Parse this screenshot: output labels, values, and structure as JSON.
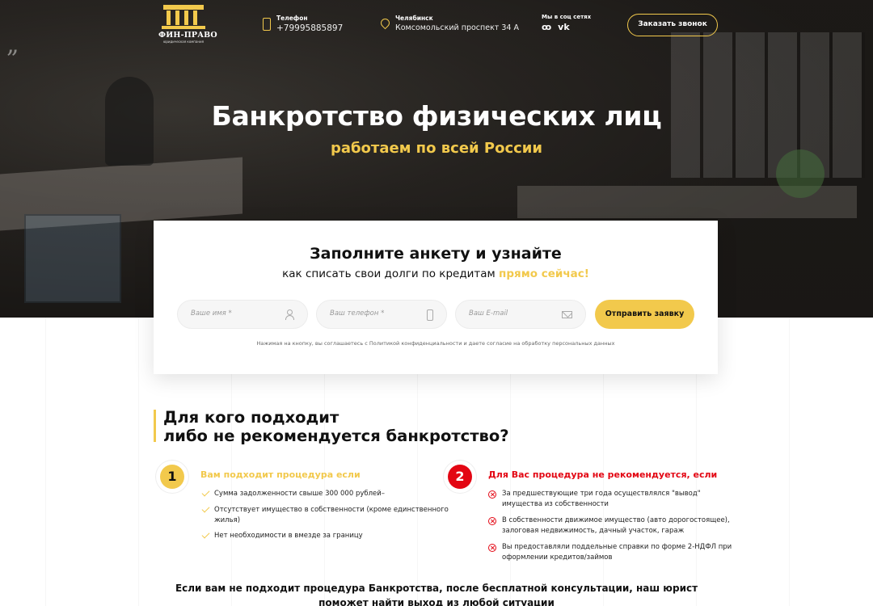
{
  "header": {
    "logo_title": "ФИН-ПРАВО",
    "logo_subtitle": "юридическая компания",
    "phone_label": "Телефон",
    "phone_value": "+79995885897",
    "city_label": "Челябинск",
    "address_value": "Комсомольский проспект 34 А",
    "social_label": "Мы в соц сетях",
    "social_icons": [
      "odnoklassniki-icon",
      "vk-icon"
    ],
    "call_button": "Заказать звонок"
  },
  "hero": {
    "title": "Банкротство физических лиц",
    "subtitle": "работаем по всей России"
  },
  "form": {
    "title": "Заполните анкету и узнайте",
    "subtitle_main": "как списать свои долги по кредитам ",
    "subtitle_accent": "прямо сейчас!",
    "name_placeholder": "Ваше имя  *",
    "phone_placeholder": "Ваш телефон  *",
    "email_placeholder": "Ваш E-mail",
    "submit_label": "Отправить заявку",
    "consent": "Нажимая на кнопку, вы соглашаетесь с Политикой конфиденциальности и даете согласие на обработку персональных данных"
  },
  "suitability": {
    "title_line1": "Для кого подходит",
    "title_line2": "либо не рекомендуется банкротство?",
    "left": {
      "number": "1",
      "title": "Вам подходит процедура если",
      "items": [
        " Сумма задолженности свыше 300 000 рублей–",
        "Отсутствует имущество в собственности (кроме единственного",
        "жилья)",
        "Нет необходимости в вмезде за границу"
      ]
    },
    "right": {
      "number": "2",
      "title": "Для Вас процедура не рекомендуется, если",
      "items": [
        "За предшествующие три года осуществлялся \"вывод\"",
        "имущества из собственности",
        "В собственности движимое имущество (авто дорогостоящее),",
        "залоговая недвижимость, дачный участок, гараж",
        "Вы предоставляли поддельные справки по форме 2-НДФЛ при",
        "оформлении кредитов/займов"
      ]
    },
    "bottom_line1": "Если вам не подходит процедура Банкротства, после бесплатной консультации, наш юрист",
    "bottom_line2": "поможет найти выход из любой ситуации"
  },
  "colors": {
    "accent_yellow": "#f2c94c",
    "accent_red": "#e30613"
  }
}
